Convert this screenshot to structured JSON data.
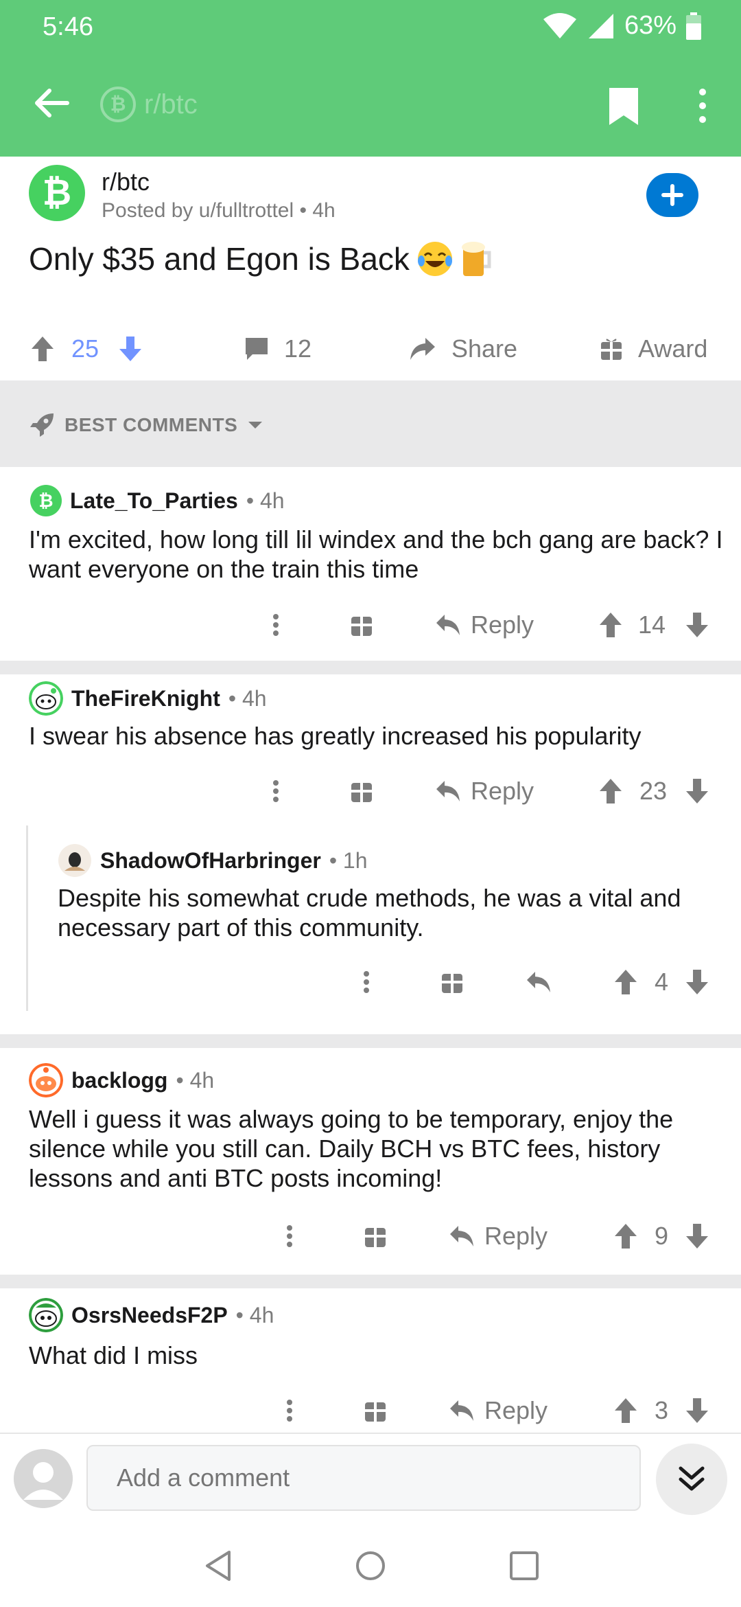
{
  "status_bar": {
    "time": "5:46",
    "battery": "63%"
  },
  "app_bar": {
    "subreddit": "r/btc",
    "icons": [
      "back-arrow-icon",
      "bookmark-icon",
      "more-vert-icon"
    ]
  },
  "post": {
    "subreddit": "r/btc",
    "posted_by": "Posted by u/fulltrottel",
    "time": "4h",
    "title": "Only $35 and Egon is Back",
    "score": "25",
    "comments": "12",
    "share_label": "Share",
    "award_label": "Award"
  },
  "sort": {
    "label": "BEST COMMENTS"
  },
  "comments": [
    {
      "user": "Late_To_Parties",
      "time": "4h",
      "body": "I'm excited, how long till lil windex and the bch gang are back? I want everyone on the train this time",
      "reply_label": "Reply",
      "score": "14"
    },
    {
      "user": "TheFireKnight",
      "time": "4h",
      "body": "I swear his absence has greatly increased his popularity",
      "reply_label": "Reply",
      "score": "23"
    },
    {
      "user": "ShadowOfHarbringer",
      "time": "1h",
      "body": "Despite his somewhat crude methods, he was a vital and necessary part of this community.",
      "score": "4"
    },
    {
      "user": "backlogg",
      "time": "4h",
      "body": "Well i guess it was always going to be temporary, enjoy the silence while you still can. Daily BCH vs BTC fees, history lessons and anti BTC posts incoming!",
      "reply_label": "Reply",
      "score": "9"
    },
    {
      "user": "OsrsNeedsF2P",
      "time": "4h",
      "body": "What did I miss",
      "reply_label": "Reply",
      "score": "3"
    }
  ],
  "composer": {
    "placeholder": "Add a comment"
  },
  "colors": {
    "app_bar": "#5fcb79",
    "accent_blue": "#0079d3",
    "upvote_blue": "#7193ff",
    "sort_bg": "#e9e9ea"
  }
}
